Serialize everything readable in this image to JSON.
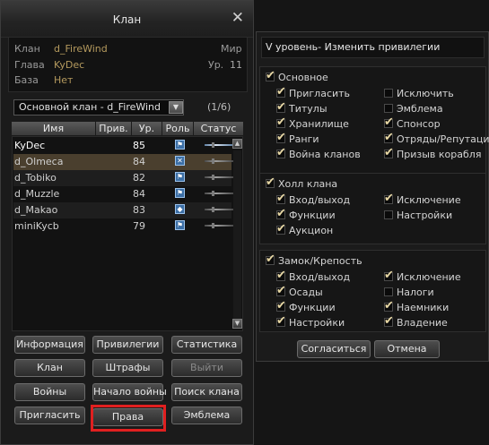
{
  "window": {
    "title": "Клан"
  },
  "clan_info": {
    "clan_label": "Клан",
    "clan_value": "d_FireWind",
    "leader_label": "Глава",
    "leader_value": "KyDec",
    "base_label": "База",
    "base_value": "Нет",
    "world_label": "Мир",
    "level_label": "Ур.",
    "level_value": "11"
  },
  "clan_select": {
    "value": "Основной клан - d_FireWind",
    "page": "(1/6)"
  },
  "member_table": {
    "headers": [
      "Имя",
      "Прив.",
      "Ур.",
      "Роль",
      "Статус"
    ],
    "rows": [
      {
        "name": "KyDec",
        "priv": "",
        "level": "85",
        "online": true
      },
      {
        "name": "d_Olmeca",
        "priv": "",
        "level": "84",
        "online": false
      },
      {
        "name": "d_Tobiko",
        "priv": "",
        "level": "82",
        "online": false
      },
      {
        "name": "d_Muzzle",
        "priv": "",
        "level": "84",
        "online": false
      },
      {
        "name": "d_Makao",
        "priv": "",
        "level": "83",
        "online": false
      },
      {
        "name": "miniKycb",
        "priv": "",
        "level": "79",
        "online": false
      }
    ]
  },
  "buttons": {
    "info": "Информация",
    "privileges": "Привилегии",
    "statistics": "Статистика",
    "clan": "Клан",
    "penalties": "Штрафы",
    "leave": "Выйти",
    "wars": "Войны",
    "start_war": "Начало войны",
    "search_clan": "Поиск клана",
    "invite": "Пригласить",
    "rights": "Права",
    "emblem": "Эмблема"
  },
  "privileges_panel": {
    "header": "V уровень- Изменить привилегии",
    "main_group": {
      "title": "Основное",
      "items": [
        {
          "label": "Пригласить",
          "checked": true
        },
        {
          "label": "Исключить",
          "checked": false
        },
        {
          "label": "Титулы",
          "checked": true
        },
        {
          "label": "Эмблема",
          "checked": false
        },
        {
          "label": "Хранилище",
          "checked": true
        },
        {
          "label": "Спонсор",
          "checked": true
        },
        {
          "label": "Ранги",
          "checked": true
        },
        {
          "label": "Отряды/Репутация",
          "checked": true
        },
        {
          "label": "Война кланов",
          "checked": true
        },
        {
          "label": "Призыв корабля",
          "checked": true
        }
      ]
    },
    "hall_group": {
      "title": "Холл клана",
      "items": [
        {
          "label": "Вход/выход",
          "checked": true
        },
        {
          "label": "Исключение",
          "checked": true
        },
        {
          "label": "Функции",
          "checked": true
        },
        {
          "label": "Настройки",
          "checked": false
        },
        {
          "label": "Аукцион",
          "checked": true
        }
      ]
    },
    "castle_group": {
      "title": "Замок/Крепость",
      "items": [
        {
          "label": "Вход/выход",
          "checked": true
        },
        {
          "label": "Исключение",
          "checked": true
        },
        {
          "label": "Осады",
          "checked": true
        },
        {
          "label": "Налоги",
          "checked": false
        },
        {
          "label": "Функции",
          "checked": true
        },
        {
          "label": "Наемники",
          "checked": true
        },
        {
          "label": "Настройки",
          "checked": true
        },
        {
          "label": "Владение",
          "checked": true
        }
      ]
    },
    "ok_button": "Согласиться",
    "cancel_button": "Отмена"
  },
  "colors": {
    "highlight_border": "#e02020",
    "name_value": "#b59a5e",
    "selected_row": "#4a3f2e"
  },
  "icons": {
    "close": "close-icon",
    "dropdown": "chevron-down-icon",
    "role": "role-icon",
    "status": "status-icon"
  }
}
